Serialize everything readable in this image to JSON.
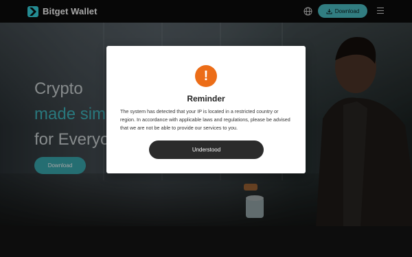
{
  "header": {
    "brand": "Bitget Wallet",
    "language_icon": "globe-icon",
    "download_label": "Download",
    "menu_icon": "hamburger-menu-icon"
  },
  "hero": {
    "line1": "Crypto",
    "line2": "made sim",
    "line3": "for Everyo",
    "download_label": "Download"
  },
  "modal": {
    "icon": "exclamation-icon",
    "title": "Reminder",
    "message": "The system has detected that your IP is located in a restricted country or region. In accordance with applicable laws and regulations, please be advised that we are not be able to provide our services to you.",
    "button_label": "Understood"
  },
  "colors": {
    "accent": "#4cc0c6",
    "warning": "#ec6d18",
    "modal_button": "#2b2b2b",
    "header_bg": "#0c0c0c"
  }
}
